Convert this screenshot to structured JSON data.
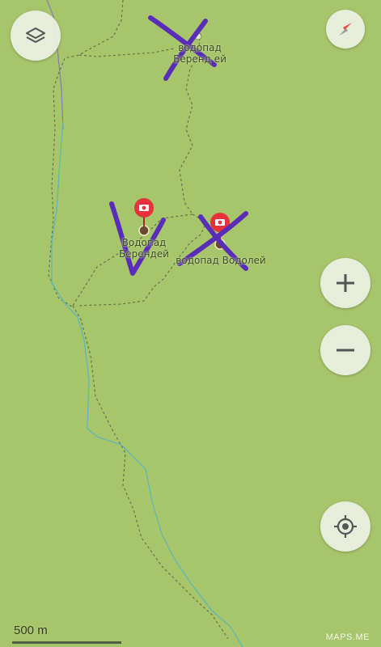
{
  "map": {
    "labels": [
      {
        "line1": "водопад",
        "line2": "Беренд ей"
      },
      {
        "line1": "Водопад",
        "line2": "Берендей"
      },
      {
        "line1": "водопад Водолей",
        "line2": ""
      }
    ],
    "scale": {
      "text": "500 m"
    },
    "brand": "MAPS.ME",
    "colors": {
      "land": "#a7c56b",
      "pin": "#e5323b",
      "marker": "#5a2db8",
      "river": "#5fb7b8"
    }
  },
  "controls": {
    "layers_icon": "layers-icon",
    "compass_icon": "compass-icon",
    "zoom_in_icon": "plus-icon",
    "zoom_out_icon": "minus-icon",
    "locate_icon": "my-location-icon"
  }
}
